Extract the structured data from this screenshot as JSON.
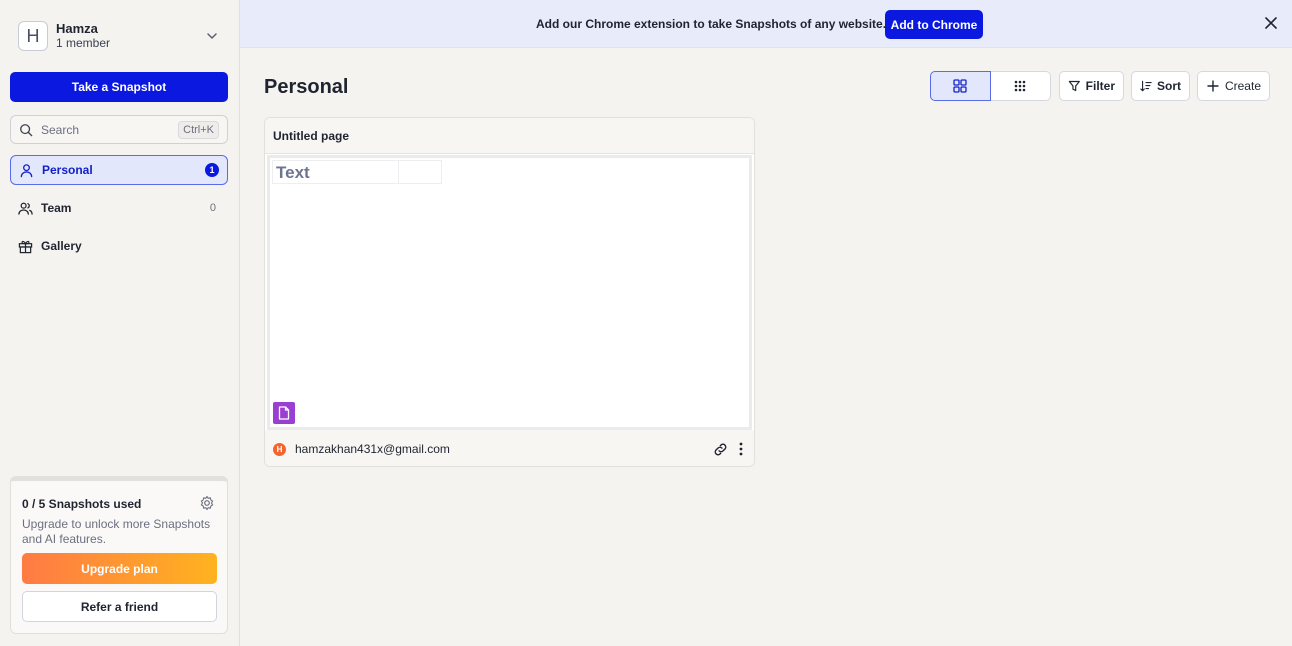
{
  "workspace": {
    "avatar_letter": "H",
    "name": "Hamza",
    "members": "1 member"
  },
  "sidebar": {
    "snapshot_button": "Take a Snapshot",
    "search": {
      "placeholder": "Search",
      "shortcut": "Ctrl+K"
    },
    "items": [
      {
        "label": "Personal",
        "count": "1",
        "icon": "person-icon",
        "active": true
      },
      {
        "label": "Team",
        "count": "0",
        "icon": "team-icon",
        "active": false
      },
      {
        "label": "Gallery",
        "icon": "gift-icon",
        "active": false
      }
    ],
    "usage": {
      "title": "0 / 5 Snapshots used",
      "description": "Upgrade to unlock more Snapshots and AI features.",
      "upgrade_label": "Upgrade plan",
      "refer_label": "Refer a friend"
    }
  },
  "banner": {
    "text": "Add our Chrome extension to take Snapshots of any website.",
    "button": "Add to Chrome"
  },
  "header": {
    "title": "Personal",
    "filter_label": "Filter",
    "sort_label": "Sort",
    "create_label": "Create"
  },
  "card": {
    "title": "Untitled page",
    "preview_text": "Text",
    "owner_initial": "H",
    "owner_email": "hamzakhan431x@gmail.com"
  },
  "colors": {
    "accent": "#0a18e0",
    "doc_badge": "#9b3fd0",
    "owner_avatar": "#f2662e"
  }
}
